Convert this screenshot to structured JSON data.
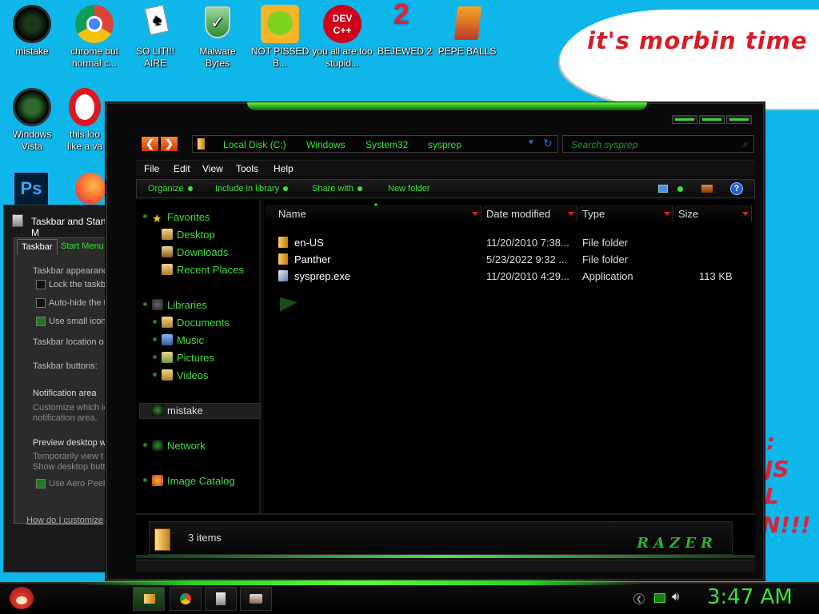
{
  "desktop": {
    "icons_row1": [
      {
        "label": "mistake"
      },
      {
        "label": "chrome but normal c..."
      },
      {
        "label": "SO LIT!!! AIRE"
      },
      {
        "label": "Malware Bytes"
      },
      {
        "label": "NOT PISSED B..."
      },
      {
        "label": "you all are too stupid..."
      },
      {
        "label": "BEJEWED 2"
      },
      {
        "label": "PEPE BALLS"
      }
    ],
    "icons_row2": [
      {
        "label": "Windows Vista"
      },
      {
        "label": "this loo like a va"
      }
    ],
    "note_text": "it's morbin time",
    "dev_badge": "DEV C++"
  },
  "taskbar_window": {
    "title": "Taskbar and Start M",
    "tab_taskbar": "Taskbar",
    "tab_start": "Start Menu",
    "section1": "Taskbar appearanc",
    "opt_lock": "Lock the taskba",
    "opt_autohide": "Auto-hide the t",
    "opt_small": "Use small icons",
    "location_label": "Taskbar location o",
    "buttons_label": "Taskbar buttons:",
    "notif_header": "Notification area",
    "notif_text1": "Customize which ic",
    "notif_text2": "notification area.",
    "preview_header": "Preview desktop w",
    "preview_text1": "Temporarily view t",
    "preview_text2": "Show desktop butt",
    "opt_peek": "Use Aero Peek",
    "help_link": "How do I customize"
  },
  "explorer": {
    "address": [
      "Local Disk (C:)",
      "Windows",
      "System32",
      "sysprep"
    ],
    "search_placeholder": "Search sysprep",
    "menu": [
      "File",
      "Edit",
      "View",
      "Tools",
      "Help"
    ],
    "commands": [
      "Organize",
      "Include in library",
      "Share with",
      "New folder"
    ],
    "nav": {
      "favorites": "Favorites",
      "desktop": "Desktop",
      "downloads": "Downloads",
      "recent": "Recent Places",
      "libraries": "Libraries",
      "documents": "Documents",
      "music": "Music",
      "pictures": "Pictures",
      "videos": "Videos",
      "homegroup": "mistake",
      "network": "Network",
      "catalog": "Image Catalog"
    },
    "columns": {
      "name": "Name",
      "date": "Date modified",
      "type": "Type",
      "size": "Size"
    },
    "files": [
      {
        "name": "en-US",
        "date": "11/20/2010 7:38...",
        "type": "File folder",
        "size": ""
      },
      {
        "name": "Panther",
        "date": "5/23/2022 9:32 ...",
        "type": "File folder",
        "size": ""
      },
      {
        "name": "sysprep.exe",
        "date": "11/20/2010 4:29...",
        "type": "Application",
        "size": "113 KB"
      }
    ],
    "status": "3 items",
    "brand": "RAZER"
  },
  "taskbar": {
    "clock": "3:47 AM"
  },
  "colors": {
    "accent": "#37e637",
    "desktop": "#0fb6ea",
    "note_red": "#d81b26"
  }
}
